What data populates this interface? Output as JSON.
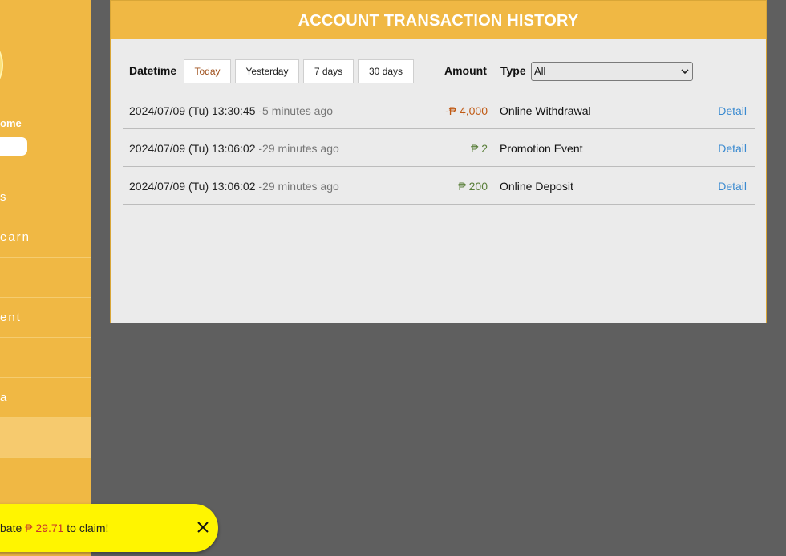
{
  "sidebar": {
    "welcome": "ome",
    "items": [
      {
        "label": "s"
      },
      {
        "label": "earn"
      },
      {
        "label": ""
      },
      {
        "label": "ent"
      },
      {
        "label": ""
      },
      {
        "label": "a"
      },
      {
        "label": ""
      },
      {
        "label": ""
      }
    ],
    "active_index": 6
  },
  "panel": {
    "title": "ACCOUNT TRANSACTION HISTORY",
    "filters": {
      "datetime_label": "Datetime",
      "buttons": [
        "Today",
        "Yesterday",
        "7 days",
        "30 days"
      ],
      "active_button": "Today",
      "amount_label": "Amount",
      "type_label": "Type",
      "type_value": "All"
    },
    "transactions": [
      {
        "datetime": "2024/07/09 (Tu) 13:30:45",
        "ago": "-5 minutes ago",
        "amount": "-₱ 4,000",
        "direction": "negative",
        "type": "Online Withdrawal",
        "detail": "Detail"
      },
      {
        "datetime": "2024/07/09 (Tu) 13:06:02",
        "ago": "-29 minutes ago",
        "amount": "₱ 2",
        "direction": "positive",
        "type": "Promotion Event",
        "detail": "Detail"
      },
      {
        "datetime": "2024/07/09 (Tu) 13:06:02",
        "ago": "-29 minutes ago",
        "amount": "₱ 200",
        "direction": "positive",
        "type": "Online Deposit",
        "detail": "Detail"
      }
    ]
  },
  "toast": {
    "prefix": "bate ",
    "amount": "₱ 29.71",
    "suffix": " to claim!"
  },
  "colors": {
    "brand": "#f0b844",
    "negative": "#c05a14",
    "positive": "#5a7f3a",
    "link": "#3a8ad0",
    "toast": "#fff500"
  }
}
